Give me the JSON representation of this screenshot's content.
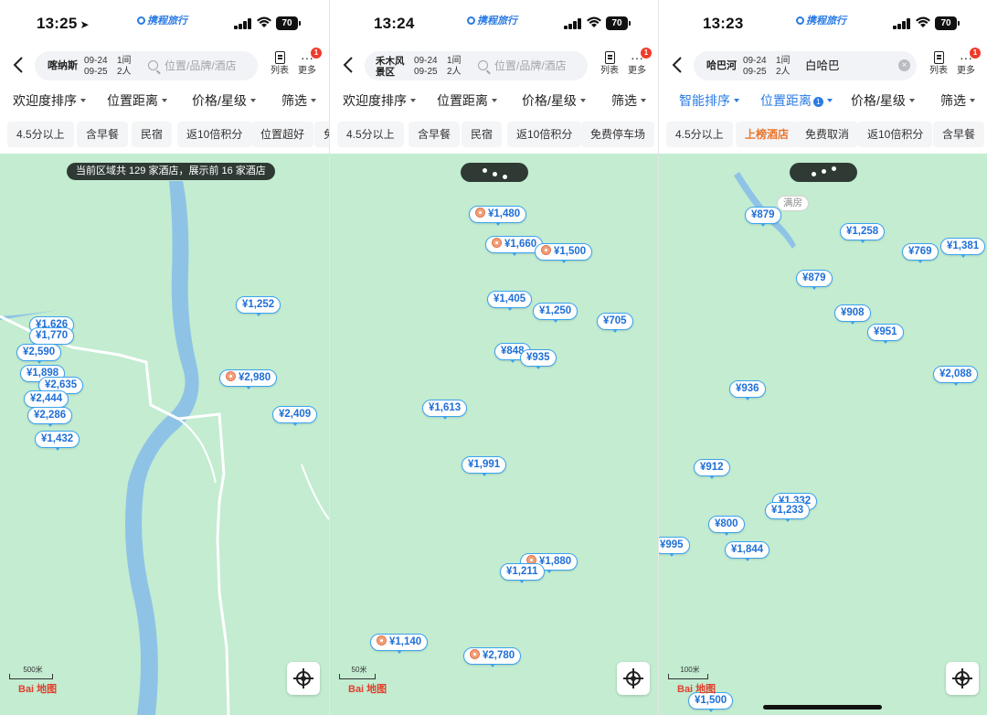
{
  "screens": [
    {
      "time": "13:25",
      "battery": "70",
      "brand": "携程旅行",
      "location": "喀纳斯",
      "location_lines": [],
      "dates": [
        "09-24",
        "09-25"
      ],
      "guests": [
        "1间",
        "2人"
      ],
      "search_placeholder": "位置/品牌/酒店",
      "keyword": "",
      "list_label": "列表",
      "more_label": "更多",
      "more_badge": "1",
      "sorts": [
        "欢迎度排序",
        "位置距离",
        "价格/星级",
        "筛选"
      ],
      "chips": [
        "4.5分以上",
        "含早餐",
        "民宿",
        "返10倍积分",
        "位置超好",
        "免"
      ],
      "map_banner": "当前区域共 129 家酒店，展示前 16 家酒店",
      "scale_label": "500米",
      "map_logo": "Bai 地图",
      "prices": [
        "¥1,626",
        "¥1,770",
        "¥2,590",
        "¥1,898",
        "¥2,635",
        "¥2,444",
        "¥2,286",
        "¥1,432",
        "¥1,252",
        "¥2,980",
        "¥2,409"
      ]
    },
    {
      "time": "13:24",
      "battery": "70",
      "brand": "携程旅行",
      "location": "",
      "location_lines": [
        "禾木风",
        "景区"
      ],
      "dates": [
        "09-24",
        "09-25"
      ],
      "guests": [
        "1间",
        "2人"
      ],
      "search_placeholder": "位置/品牌/酒店",
      "keyword": "",
      "list_label": "列表",
      "more_label": "更多",
      "more_badge": "1",
      "sorts": [
        "欢迎度排序",
        "位置距离",
        "价格/星级",
        "筛选"
      ],
      "chips": [
        "4.5分以上",
        "含早餐",
        "民宿",
        "返10倍积分",
        "免费停车场"
      ],
      "scale_label": "50米",
      "map_logo": "Bai 地图",
      "prices": [
        "¥1,480",
        "¥1,660",
        "¥1,500",
        "¥1,405",
        "¥1,250",
        "¥705",
        "¥848",
        "¥935",
        "¥1,613",
        "¥1,991",
        "¥1,880",
        "¥1,211",
        "¥1,140",
        "¥2,780"
      ]
    },
    {
      "time": "13:23",
      "battery": "70",
      "brand": "携程旅行",
      "location": "哈巴河",
      "location_lines": [],
      "dates": [
        "09-24",
        "09-25"
      ],
      "guests": [
        "1间",
        "2人"
      ],
      "search_placeholder": "",
      "keyword": "白哈巴",
      "list_label": "列表",
      "more_label": "更多",
      "more_badge": "1",
      "sorts": [
        "智能排序",
        "位置距离",
        "价格/星级",
        "筛选"
      ],
      "sort_badge": "1",
      "chips": [
        "4.5分以上",
        "上榜酒店",
        "免费取消",
        "返10倍积分",
        "含早餐"
      ],
      "full_label": "满房",
      "scale_label": "100米",
      "map_logo": "Bai 地图",
      "prices": [
        "¥879",
        "¥1,258",
        "¥769",
        "¥1,381",
        "¥879",
        "¥908",
        "¥951",
        "¥2,088",
        "¥936",
        "¥912",
        "¥1,332",
        "¥1,233",
        "¥800",
        "¥995",
        "¥1,844",
        "¥1,500"
      ]
    }
  ],
  "colors": {
    "accent": "#2a7be4",
    "map_land": "#c3ecd1",
    "map_water": "#8fc3e6",
    "price_text": "#1f6fd6",
    "highlight_chip": "#e8742c",
    "badge": "#f03a2a"
  }
}
